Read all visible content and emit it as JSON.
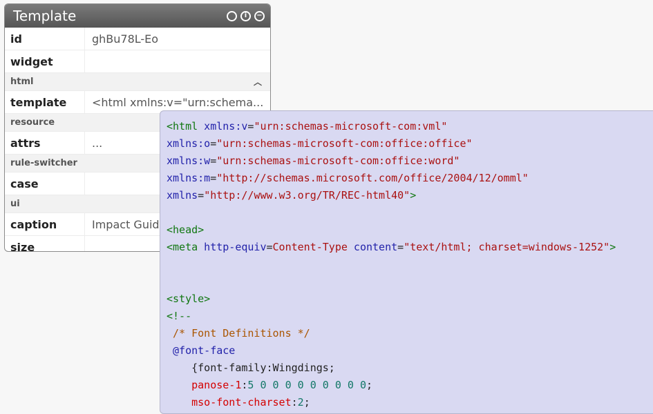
{
  "panel": {
    "title": "Template",
    "icons": [
      "circle-icon",
      "info-icon",
      "minus-circle-icon"
    ],
    "rows": {
      "id": {
        "key": "id",
        "value": "ghBu78L-Eo"
      },
      "widget": {
        "key": "widget",
        "value": ""
      },
      "template": {
        "key": "template",
        "value": "<html xmlns:v=\"urn:schema..."
      },
      "attrs": {
        "key": "attrs",
        "value": "..."
      },
      "case": {
        "key": "case",
        "value": ""
      },
      "caption": {
        "key": "caption",
        "value": "Impact Guida"
      },
      "size": {
        "key": "size",
        "value": ""
      }
    },
    "sections": {
      "html": "html",
      "resource": "resource",
      "rule_switcher": "rule-switcher",
      "ui": "ui"
    }
  },
  "code": {
    "l1": {
      "a": "<html",
      "b": " xmlns:v",
      "c": "=",
      "d": "\"urn:schemas-microsoft-com:vml\""
    },
    "l2": {
      "b": "xmlns:o",
      "c": "=",
      "d": "\"urn:schemas-microsoft-com:office:office\""
    },
    "l3": {
      "b": "xmlns:w",
      "c": "=",
      "d": "\"urn:schemas-microsoft-com:office:word\""
    },
    "l4": {
      "b": "xmlns:m",
      "c": "=",
      "d": "\"http://schemas.microsoft.com/office/2004/12/omml\""
    },
    "l5": {
      "b": "xmlns",
      "c": "=",
      "d": "\"http://www.w3.org/TR/REC-html40\"",
      "e": ">"
    },
    "l7": {
      "a": "<head>"
    },
    "l8": {
      "a": "<meta",
      "b": " http-equiv",
      "c": "=",
      "d": "Content-Type",
      "e": " content",
      "f": "=",
      "g": "\"text/html; charset=windows-1252\"",
      "h": ">"
    },
    "l11": {
      "a": "<style>"
    },
    "l12": {
      "a": "<!--"
    },
    "l13": {
      "a": " /* Font Definitions */"
    },
    "l14": {
      "a": " @font-face"
    },
    "l15": {
      "a": "    {font-family:Wingdings;"
    },
    "l16": {
      "a": "    panose-1",
      "b": ":",
      "c": "5 0 0 0 0 0 0 0 0 0",
      "d": ";"
    },
    "l17": {
      "a": "    mso-font-charset",
      "b": ":",
      "c": "2",
      "d": ";"
    }
  }
}
